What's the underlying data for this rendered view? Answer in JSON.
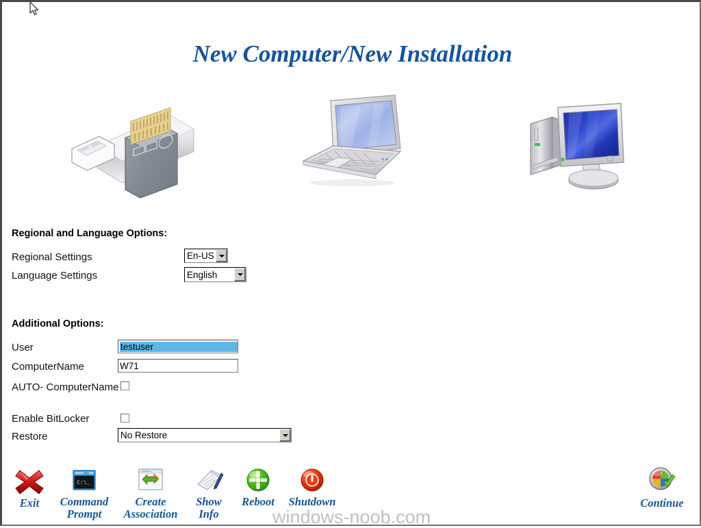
{
  "window": {
    "title": "New Computer/New Installation",
    "watermark": "windows-noob.com",
    "title_color": "#15559c",
    "selection_color": "#5db8e8"
  },
  "illustrations": [
    {
      "name": "usb-flash-drive-image",
      "alt": "USB flash drive"
    },
    {
      "name": "laptop-image",
      "alt": "Laptop computer"
    },
    {
      "name": "desktop-pc-image",
      "alt": "Desktop computer with monitor"
    }
  ],
  "regional_section": {
    "heading": "Regional and Language Options:",
    "fields": [
      {
        "label": "Regional  Settings",
        "value": "En-US",
        "options": [
          "En-US"
        ]
      },
      {
        "label": "Language  Settings",
        "value": "English",
        "options": [
          "English"
        ]
      }
    ]
  },
  "additional_section": {
    "heading": "Additional Options:",
    "fields": [
      {
        "label": "User",
        "value": "testuser",
        "type": "text",
        "selected": true
      },
      {
        "label": "ComputerName",
        "value": "W71",
        "type": "text",
        "selected": false
      },
      {
        "label": "AUTO-\nComputerName",
        "value": "",
        "type": "checkbox",
        "checked": false
      },
      {
        "label": "Enable  BitLocker",
        "value": "",
        "type": "checkbox",
        "checked": false
      },
      {
        "label": "Restore",
        "value": "No Restore",
        "type": "select",
        "options": [
          "No Restore"
        ]
      }
    ]
  },
  "toolbar": {
    "items": [
      {
        "label": "Exit",
        "icon": "red-x-icon"
      },
      {
        "label": "Command\nPrompt",
        "icon": "command-prompt-icon"
      },
      {
        "label": "Create\nAssociation",
        "icon": "create-association-icon"
      },
      {
        "label": "Show\nInfo",
        "icon": "show-info-icon"
      },
      {
        "label": "Reboot",
        "icon": "reboot-icon"
      },
      {
        "label": "Shutdown",
        "icon": "shutdown-icon"
      }
    ],
    "continue": {
      "label": "Continue",
      "icon": "windows-continue-icon"
    }
  }
}
